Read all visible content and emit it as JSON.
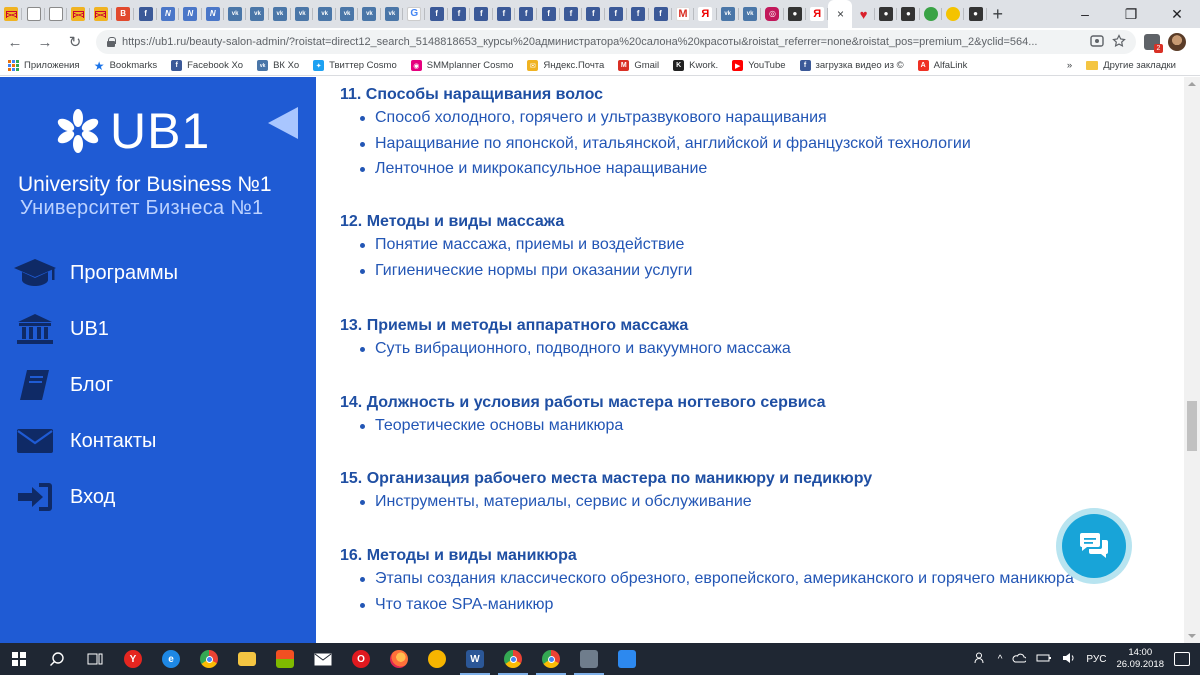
{
  "browser": {
    "tab_favicons": [
      "mail",
      "doc",
      "doc",
      "mail",
      "mail",
      "b",
      "fb",
      "n",
      "n",
      "n",
      "vk",
      "vk",
      "vk",
      "vk",
      "vk",
      "vk",
      "vk",
      "vk",
      "g",
      "fb",
      "fb",
      "fb",
      "fb",
      "fb",
      "fb",
      "fb",
      "fb",
      "fb",
      "fb",
      "fb",
      "gm",
      "red",
      "vk",
      "vk",
      "ig",
      "dark",
      "red"
    ],
    "extra_tab_favicons": [
      "heart",
      "dark",
      "dark",
      "green",
      "bee",
      "dark"
    ],
    "active_tab_close": "×",
    "new_tab": "+",
    "window": {
      "minimize": "–",
      "restore": "❐",
      "close": "✕"
    },
    "nav": {
      "back": "←",
      "forward": "→",
      "reload": "↻"
    },
    "url": "https://ub1.ru/beauty-salon-admin/?roistat=direct12_search_5148818653_курсы%20администратора%20салона%20красоты&roistat_referrer=none&roistat_pos=premium_2&yclid=564...",
    "ext_badge": "2",
    "bookmarks": [
      {
        "label": "Приложения",
        "icon": "apps-icon"
      },
      {
        "label": "Bookmarks",
        "icon": "star-icon",
        "color": "#1a73e8"
      },
      {
        "label": "Facebook Xo",
        "icon": "facebook-icon",
        "color": "#3b5998"
      },
      {
        "label": "ВК Хо",
        "icon": "vk-icon",
        "color": "#4a76a8"
      },
      {
        "label": "Твиттер Cosmo",
        "icon": "twitter-icon",
        "color": "#1da1f2"
      },
      {
        "label": "SMMplanner Cosmo",
        "icon": "smmplanner-icon",
        "color": "#e6007e"
      },
      {
        "label": "Яндекс.Почта",
        "icon": "mail-icon",
        "color": "#f0b322"
      },
      {
        "label": "Gmail",
        "icon": "gmail-icon",
        "color": "#d93025"
      },
      {
        "label": "Kwork.",
        "icon": "kwork-icon",
        "color": "#222222"
      },
      {
        "label": "YouTube",
        "icon": "youtube-icon",
        "color": "#ff0000"
      },
      {
        "label": "загрузка видео из ©",
        "icon": "facebook-icon",
        "color": "#3b5998"
      },
      {
        "label": "AlfaLink",
        "icon": "alfa-icon",
        "color": "#ef3124"
      }
    ],
    "bookmarks_overflow": "»",
    "other_bookmarks": "Другие закладки"
  },
  "sidebar": {
    "logo_text": "UB1",
    "title_en": "University for Business №1",
    "title_ru": "Университет Бизнеса №1",
    "nav": [
      {
        "label": "Программы",
        "icon": "graduation-cap-icon"
      },
      {
        "label": "UB1",
        "icon": "institution-icon"
      },
      {
        "label": "Блог",
        "icon": "book-icon"
      },
      {
        "label": "Контакты",
        "icon": "envelope-icon"
      },
      {
        "label": "Вход",
        "icon": "sign-in-icon"
      }
    ],
    "colors": {
      "bg": "#1f5bd4",
      "icon": "#0f2a66"
    }
  },
  "content": {
    "sections": [
      {
        "title": "11. Способы наращивания волос",
        "items": [
          "Способ холодного, горячего и ультразвукового наращивания",
          "Наращивание по японской, итальянской, английской и французской технологии",
          "Ленточное и микрокапсульное наращивание"
        ]
      },
      {
        "title": "12. Методы и виды массажа",
        "items": [
          "Понятие массажа, приемы и воздействие",
          "Гигиенические нормы при оказании услуги"
        ]
      },
      {
        "title": "13. Приемы и методы аппаратного массажа",
        "items": [
          "Суть вибрационного, подводного и вакуумного массажа"
        ]
      },
      {
        "title": "14. Должность и условия работы мастера ногтевого сервиса",
        "items": [
          "Теоретические основы маникюра"
        ]
      },
      {
        "title": "15. Организация рабочего места мастера по маникюру и педикюру",
        "items": [
          "Инструменты, материалы, сервис и обслуживание"
        ]
      },
      {
        "title": "16. Методы и виды маникюра",
        "items": [
          "Этапы создания классического обрезного, европейского, американского и горячего маникюра",
          "Что такое SPA-маникюр"
        ]
      }
    ],
    "colors": {
      "title": "#1f4fa3",
      "text": "#2356b5"
    }
  },
  "chat_button": {
    "icon": "chat-icon",
    "color": "#18a4d8"
  },
  "taskbar": {
    "apps": [
      {
        "name": "start-icon",
        "color": "#ffffff",
        "glyph": ""
      },
      {
        "name": "search-icon",
        "color": "#ffffff",
        "glyph": ""
      },
      {
        "name": "task-view-icon",
        "color": "#ffffff",
        "glyph": ""
      },
      {
        "name": "yandex-browser-icon",
        "color": "#e52620",
        "glyph": "Y"
      },
      {
        "name": "edge-icon",
        "color": "#1e88e5",
        "glyph": "e"
      },
      {
        "name": "chrome-icon",
        "color": "#34a853",
        "glyph": ""
      },
      {
        "name": "file-explorer-icon",
        "color": "#f4c542",
        "glyph": ""
      },
      {
        "name": "store-icon",
        "color": "#dddddd",
        "glyph": ""
      },
      {
        "name": "mail-icon",
        "color": "#ffffff",
        "glyph": ""
      },
      {
        "name": "opera-icon",
        "color": "#e0191f",
        "glyph": "O"
      },
      {
        "name": "firefox-icon",
        "color": "#ff7139",
        "glyph": ""
      },
      {
        "name": "clock-app-icon",
        "color": "#f7b500",
        "glyph": ""
      },
      {
        "name": "word-icon",
        "color": "#2b5797",
        "glyph": "W"
      },
      {
        "name": "chrome-icon",
        "color": "#34a853",
        "glyph": ""
      },
      {
        "name": "chrome-icon",
        "color": "#34a853",
        "glyph": ""
      },
      {
        "name": "app-icon",
        "color": "#6f7d8c",
        "glyph": ""
      },
      {
        "name": "photos-icon",
        "color": "#2d89ef",
        "glyph": ""
      }
    ],
    "open_apps": [
      12,
      13,
      14,
      15
    ],
    "language": "РУС",
    "time": "14:00",
    "date": "26.09.2018"
  }
}
